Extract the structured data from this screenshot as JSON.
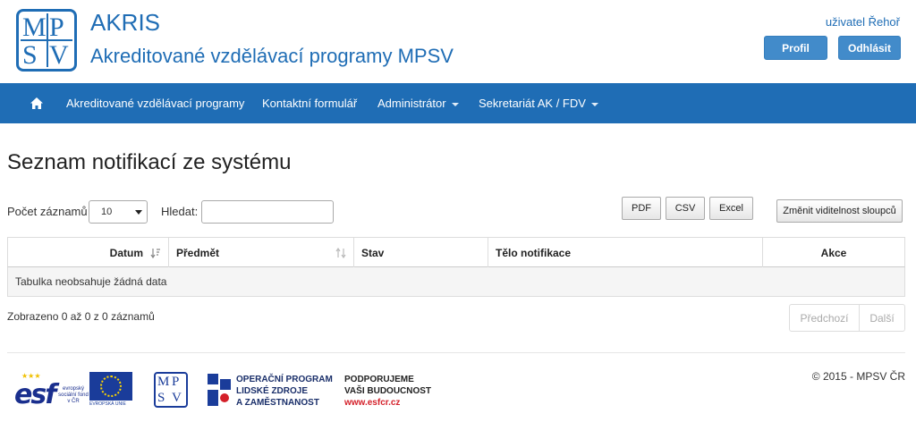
{
  "header": {
    "logo_letters": [
      "M",
      "P",
      "S",
      "V"
    ],
    "app_title": "AKRIS",
    "app_subtitle": "Akreditované vzdělávací programy MPSV",
    "user_label": "uživatel Řehoř",
    "profile_button": "Profil",
    "logout_button": "Odhlásit"
  },
  "nav": {
    "home_icon": "home-icon",
    "items": [
      {
        "label": "Akreditované vzdělávací programy",
        "dropdown": false
      },
      {
        "label": "Kontaktní formulář",
        "dropdown": false
      },
      {
        "label": "Administrátor",
        "dropdown": true
      },
      {
        "label": "Sekretariát AK / FDV",
        "dropdown": true
      }
    ]
  },
  "page": {
    "title": "Seznam notifikací ze systému"
  },
  "controls": {
    "records_label": "Počet záznamů",
    "records_value": "10",
    "search_label": "Hledat:",
    "search_value": "",
    "pdf_button": "PDF",
    "csv_button": "CSV",
    "excel_button": "Excel",
    "columns_button": "Změnit viditelnost sloupců"
  },
  "table": {
    "columns": [
      "Datum",
      "Předmět",
      "Stav",
      "Tělo notifikace",
      "Akce"
    ],
    "empty_message": "Tabulka neobsahuje žádná data"
  },
  "pagination": {
    "info": "Zobrazeno 0 až 0 z 0 záznamů",
    "prev": "Předchozí",
    "next": "Další"
  },
  "footer": {
    "esf_word": "esf",
    "esf_caption": "evropský sociální fond v ČR",
    "eu_caption": "EVROPSKÁ UNIE",
    "op_lines": [
      "OPERAČNÍ PROGRAM",
      "LIDSKÉ ZDROJE",
      "A ZAMĚSTNANOST"
    ],
    "support_lines": [
      "PODPORUJEME",
      "VAŠI BUDOUCNOST"
    ],
    "support_url": "www.esfcr.cz",
    "copyright": "© 2015 - MPSV ČR"
  },
  "colors": {
    "brand_blue": "#1f6db5",
    "button_blue": "#428bca"
  }
}
